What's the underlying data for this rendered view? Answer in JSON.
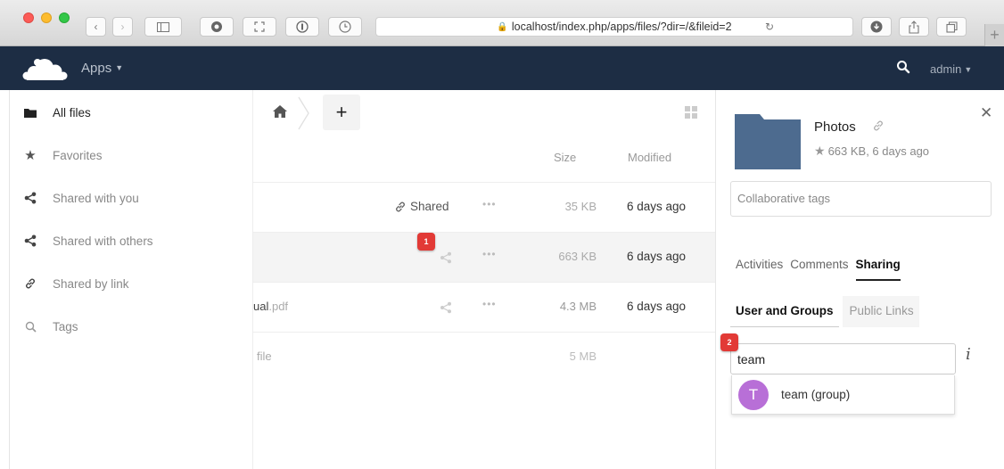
{
  "browser": {
    "url": "localhost/index.php/apps/files/?dir=/&fileid=2"
  },
  "header": {
    "apps_label": "Apps",
    "user_label": "admin"
  },
  "sidebar": {
    "items": [
      {
        "label": "All files",
        "icon": "folder-icon"
      },
      {
        "label": "Favorites",
        "icon": "star-icon"
      },
      {
        "label": "Shared with you",
        "icon": "share-icon"
      },
      {
        "label": "Shared with others",
        "icon": "share-icon"
      },
      {
        "label": "Shared by link",
        "icon": "link-icon"
      },
      {
        "label": "Tags",
        "icon": "search-icon"
      }
    ]
  },
  "filelist": {
    "columns": {
      "size": "Size",
      "modified": "Modified"
    },
    "rows": [
      {
        "name": "",
        "share_label": "Shared",
        "size": "35 KB",
        "modified": "6 days ago"
      },
      {
        "name": "",
        "share_label": "",
        "size": "663 KB",
        "modified": "6 days ago",
        "badge": "1"
      },
      {
        "name": "ual",
        "ext": ".pdf",
        "share_label": "",
        "size": "4.3 MB",
        "modified": "6 days ago"
      },
      {
        "name": "file",
        "ext": "",
        "share_label": "",
        "size": "5 MB",
        "modified": ""
      }
    ]
  },
  "details": {
    "title": "Photos",
    "meta": "663 KB, 6 days ago",
    "tags_placeholder": "Collaborative tags",
    "tabs": [
      "Activities",
      "Comments",
      "Sharing"
    ],
    "subtabs": [
      "User and Groups",
      "Public Links"
    ],
    "share_input_value": "team",
    "share_badge": "2",
    "autocomplete": {
      "avatar_letter": "T",
      "label": "team (group)"
    }
  },
  "colors": {
    "header_bg": "#1d2d44",
    "folder": "#4d6b8f",
    "badge": "#e23a36",
    "avatar": "#b86fd7"
  }
}
